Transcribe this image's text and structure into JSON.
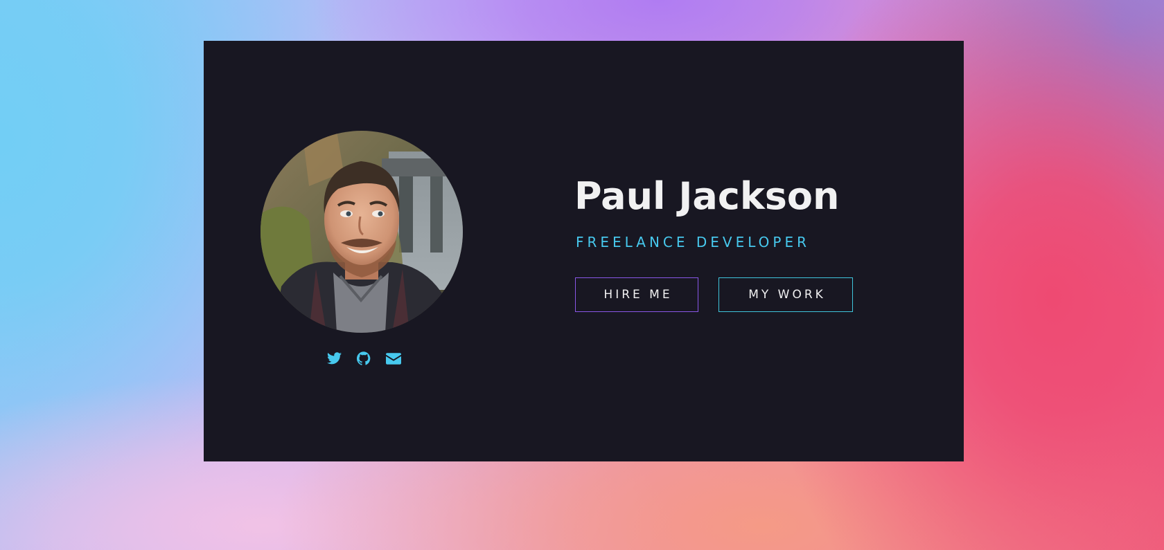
{
  "profile": {
    "name": "Paul Jackson",
    "title": "FREELANCE DEVELOPER",
    "photo_alt": "Paul Jackson"
  },
  "buttons": {
    "hire_label": "HIRE ME",
    "work_label": "MY WORK"
  },
  "socials": [
    {
      "icon": "twitter-icon",
      "label": "Twitter"
    },
    {
      "icon": "github-icon",
      "label": "GitHub"
    },
    {
      "icon": "envelope-icon",
      "label": "Email"
    }
  ],
  "colors": {
    "card_background": "#181722",
    "name_text": "#f1f1f2",
    "accent_cyan": "#47c9ee",
    "hire_border": "#8a57e8",
    "work_border": "#3fc6dd"
  }
}
